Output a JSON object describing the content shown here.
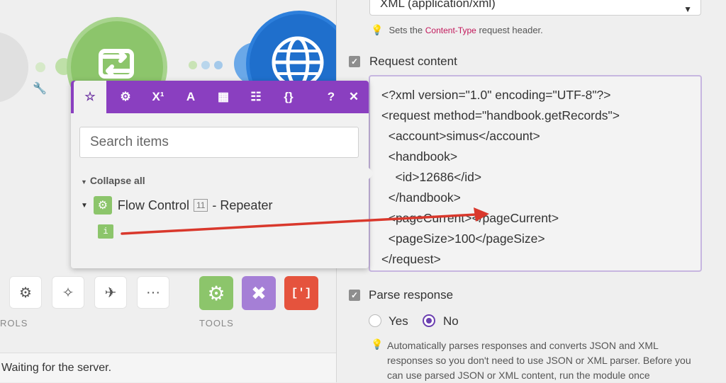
{
  "canvas": {
    "status_text": "Waiting for the server.",
    "label_left": "ROLS",
    "label_tools": "TOOLS",
    "toolbar_icons": [
      "gear-icon",
      "magic-wand-icon",
      "airplane-icon",
      "more-icon"
    ],
    "tool_tiles": [
      {
        "name": "flow-control-tool",
        "color": "#8cc56b"
      },
      {
        "name": "tools-tool",
        "color": "#a57fd6"
      },
      {
        "name": "text-parser-tool",
        "color": "#e5533d"
      }
    ]
  },
  "popup": {
    "tabs": [
      {
        "name": "star-icon",
        "glyph": "☆"
      },
      {
        "name": "gear-icon",
        "glyph": "⚙"
      },
      {
        "name": "math-icon",
        "glyph": "X¹"
      },
      {
        "name": "text-icon",
        "glyph": "A"
      },
      {
        "name": "calendar-icon",
        "glyph": "▦"
      },
      {
        "name": "table-icon",
        "glyph": "☷"
      },
      {
        "name": "braces-icon",
        "glyph": "{}"
      },
      {
        "name": "help-icon",
        "glyph": "?"
      },
      {
        "name": "close-icon",
        "glyph": "✕"
      }
    ],
    "search_placeholder": "Search items",
    "collapse_label": "Collapse all",
    "tree_module": "Flow Control",
    "tree_module_num": "11",
    "tree_module_suffix": "- Repeater",
    "item_chip": "i"
  },
  "panel": {
    "content_type_value": "XML (application/xml)",
    "hint_content_type_prefix": "Sets the",
    "hint_content_type_keyword": "Content-Type",
    "hint_content_type_suffix": "request header.",
    "request_content_label": "Request content",
    "request_content": "<?xml version=\"1.0\" encoding=\"UTF-8\"?>\n<request method=\"handbook.getRecords\">\n  <account>simus</account>\n  <handbook>\n    <id>12686</id>\n  </handbook>\n  <pageCurrent></pageCurrent>\n  <pageSize>100</pageSize>\n</request>",
    "parse_response_label": "Parse response",
    "radio_yes": "Yes",
    "radio_no": "No",
    "parse_hint": "Automatically parses responses and converts JSON and XML responses so you don't need to use JSON or XML parser. Before you can use parsed JSON or XML content, run the module once"
  },
  "colors": {
    "accent_purple": "#8a3fc0",
    "arrow_red": "#d9382c",
    "flow_green": "#8cc56b",
    "http_blue": "#1f6fcc"
  }
}
